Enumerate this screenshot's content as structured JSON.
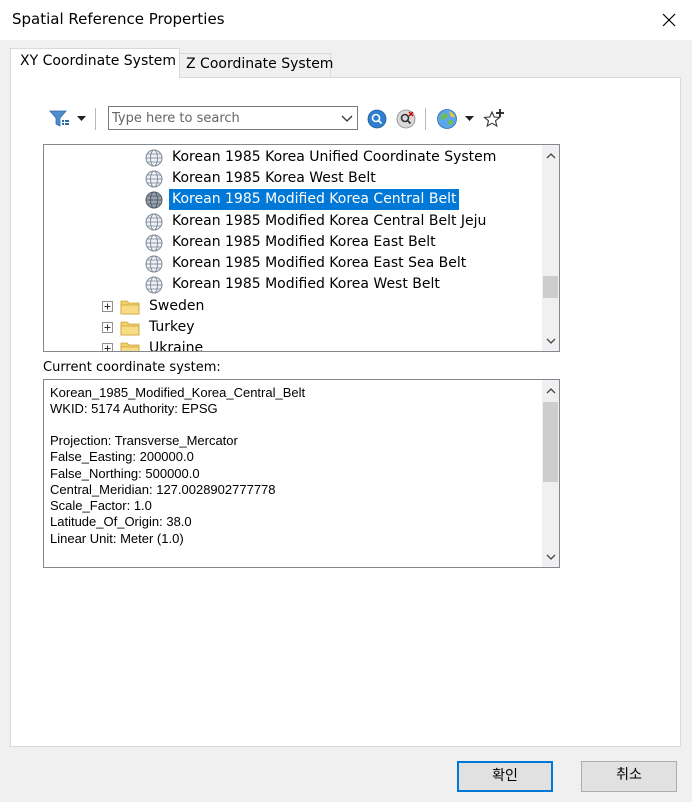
{
  "window": {
    "title": "Spatial Reference Properties"
  },
  "tabs": [
    {
      "label": "XY Coordinate System",
      "active": true
    },
    {
      "label": "Z Coordinate System",
      "active": false
    }
  ],
  "toolbar": {
    "filter_icon": "filter-icon",
    "search": {
      "value": "",
      "placeholder": "Type here to search"
    },
    "search_icon": "search-icon",
    "clear_search_icon": "clear-search-icon",
    "globe_icon": "globe-icon",
    "favorite_icon": "add-favorite-icon"
  },
  "tree": {
    "items": [
      {
        "label": "Korean 1985 Korea Unified Coordinate System",
        "type": "coordsys"
      },
      {
        "label": "Korean 1985 Korea West Belt",
        "type": "coordsys"
      },
      {
        "label": "Korean 1985 Modified Korea Central Belt",
        "type": "coordsys",
        "selected": true
      },
      {
        "label": "Korean 1985 Modified Korea Central Belt Jeju",
        "type": "coordsys"
      },
      {
        "label": "Korean 1985 Modified Korea East Belt",
        "type": "coordsys"
      },
      {
        "label": "Korean 1985 Modified Korea East Sea Belt",
        "type": "coordsys"
      },
      {
        "label": "Korean 1985 Modified Korea West Belt",
        "type": "coordsys"
      },
      {
        "label": "Sweden",
        "type": "folder"
      },
      {
        "label": "Turkey",
        "type": "folder"
      },
      {
        "label": "Ukraine",
        "type": "folder"
      }
    ]
  },
  "current": {
    "label": "Current coordinate system:",
    "lines": [
      "Korean_1985_Modified_Korea_Central_Belt",
      "WKID: 5174 Authority: EPSG",
      "",
      "Projection: Transverse_Mercator",
      "False_Easting: 200000.0",
      "False_Northing: 500000.0",
      "Central_Meridian: 127.0028902777778",
      "Scale_Factor: 1.0",
      "Latitude_Of_Origin: 38.0",
      "Linear Unit: Meter (1.0)"
    ]
  },
  "buttons": {
    "ok": "확인",
    "cancel": "취소"
  },
  "colors": {
    "selection": "#0078d7",
    "folder": "#e8c04a",
    "default_button_border": "#0078d7"
  }
}
